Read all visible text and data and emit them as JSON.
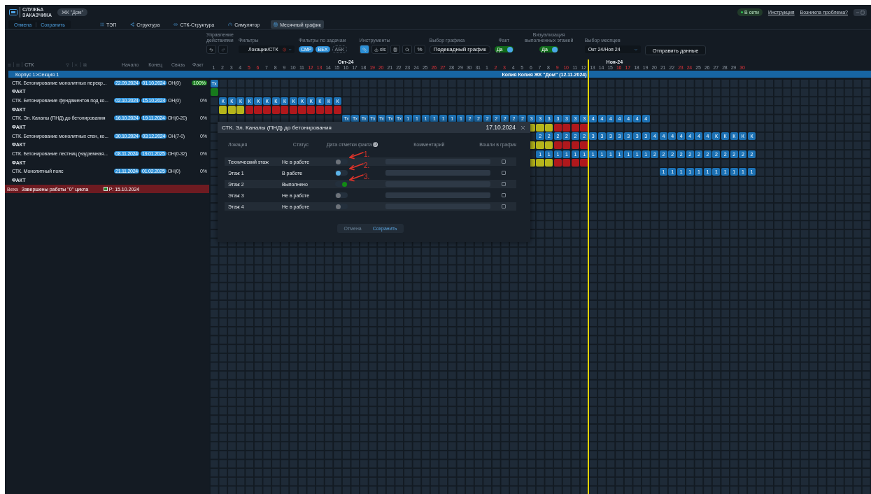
{
  "header": {
    "logo_text": "СЛУЖБА ЗАКАЗЧИКА",
    "project": "ЖК \"Дом\"",
    "online": "В сети",
    "links": [
      "Инструкция",
      "Возникла проблема?"
    ]
  },
  "actions": [
    "Отмена",
    "Сохранить"
  ],
  "tabs": [
    {
      "label": "ТЭП",
      "selected": false
    },
    {
      "label": "Структура",
      "selected": false
    },
    {
      "label": "СТК-Структура",
      "selected": false
    },
    {
      "label": "Симулятор",
      "selected": false
    },
    {
      "label": "Месячный график",
      "selected": true
    }
  ],
  "toolbar": {
    "history_label": "Управление действиями",
    "filters_label": "Фильтры",
    "filter_value": "Локации/СТК",
    "task_filters_label": "Фильтры по задачам",
    "task_filters": [
      {
        "label": "СМР",
        "on": true
      },
      {
        "label": "ВЕХ",
        "on": true
      },
      {
        "label": "АБК",
        "on": false
      }
    ],
    "tools_label": "Инструменты",
    "tools": [
      {
        "kind": "ruler",
        "selected": true
      },
      {
        "kind": "export",
        "label": "xls",
        "selected": false
      },
      {
        "kind": "calc",
        "selected": false
      },
      {
        "kind": "search",
        "selected": false
      },
      {
        "kind": "percent",
        "label": "%",
        "selected": false
      }
    ],
    "schedule_label": "Выбор графика",
    "schedule_value": "Подекадный график",
    "toggles": [
      {
        "label": "Факт",
        "value": "Да",
        "on": true
      },
      {
        "label": "Визуализация выполненных этажей",
        "value": "Да",
        "on": true
      }
    ],
    "months_label": "Выбор месяцев",
    "months_value": "Окт 24/Ноя 24",
    "submit": "Отправить данные"
  },
  "left_header": {
    "filter_text": "СТК",
    "columns": [
      "Начало",
      "Конец",
      "Связь",
      "Факт"
    ]
  },
  "months": [
    {
      "label": "Окт-24",
      "days": [
        {
          "label": "1",
          "weekend": false,
          "today": false
        },
        {
          "label": "2",
          "weekend": false,
          "today": false
        },
        {
          "label": "3",
          "weekend": false,
          "today": false
        },
        {
          "label": "4",
          "weekend": false,
          "today": false
        },
        {
          "label": "5",
          "weekend": true,
          "today": false
        },
        {
          "label": "6",
          "weekend": true,
          "today": false
        },
        {
          "label": "7",
          "weekend": false,
          "today": false
        },
        {
          "label": "8",
          "weekend": false,
          "today": false
        },
        {
          "label": "9",
          "weekend": false,
          "today": false
        },
        {
          "label": "10",
          "weekend": false,
          "today": false
        },
        {
          "label": "11",
          "weekend": false,
          "today": false
        },
        {
          "label": "12",
          "weekend": true,
          "today": false
        },
        {
          "label": "13",
          "weekend": true,
          "today": false
        },
        {
          "label": "14",
          "weekend": false,
          "today": false
        },
        {
          "label": "15",
          "weekend": false,
          "today": false
        },
        {
          "label": "16",
          "weekend": false,
          "today": false
        },
        {
          "label": "17",
          "weekend": false,
          "today": false
        },
        {
          "label": "18",
          "weekend": false,
          "today": false
        },
        {
          "label": "19",
          "weekend": true,
          "today": false
        },
        {
          "label": "20",
          "weekend": true,
          "today": false
        },
        {
          "label": "21",
          "weekend": false,
          "today": false
        },
        {
          "label": "22",
          "weekend": false,
          "today": false
        },
        {
          "label": "23",
          "weekend": false,
          "today": false
        },
        {
          "label": "24",
          "weekend": false,
          "today": false
        },
        {
          "label": "25",
          "weekend": false,
          "today": false
        },
        {
          "label": "26",
          "weekend": true,
          "today": false
        },
        {
          "label": "27",
          "weekend": true,
          "today": false
        },
        {
          "label": "28",
          "weekend": false,
          "today": false
        },
        {
          "label": "29",
          "weekend": false,
          "today": false
        },
        {
          "label": "30",
          "weekend": false,
          "today": false
        },
        {
          "label": "31",
          "weekend": false,
          "today": false
        }
      ]
    },
    {
      "label": "Ноя-24",
      "days": [
        {
          "label": "1",
          "weekend": false,
          "today": false
        },
        {
          "label": "2",
          "weekend": true,
          "today": false
        },
        {
          "label": "3",
          "weekend": true,
          "today": false
        },
        {
          "label": "4",
          "weekend": false,
          "today": false
        },
        {
          "label": "5",
          "weekend": false,
          "today": false
        },
        {
          "label": "6",
          "weekend": false,
          "today": false
        },
        {
          "label": "7",
          "weekend": false,
          "today": false
        },
        {
          "label": "8",
          "weekend": false,
          "today": false
        },
        {
          "label": "9",
          "weekend": true,
          "today": false
        },
        {
          "label": "10",
          "weekend": true,
          "today": false
        },
        {
          "label": "11",
          "weekend": false,
          "today": false
        },
        {
          "label": "12",
          "weekend": false,
          "today": true
        },
        {
          "label": "13",
          "weekend": false,
          "today": false
        },
        {
          "label": "14",
          "weekend": false,
          "today": false
        },
        {
          "label": "15",
          "weekend": false,
          "today": false
        },
        {
          "label": "16",
          "weekend": true,
          "today": false
        },
        {
          "label": "17",
          "weekend": true,
          "today": false
        },
        {
          "label": "18",
          "weekend": false,
          "today": false
        },
        {
          "label": "19",
          "weekend": false,
          "today": false
        },
        {
          "label": "20",
          "weekend": false,
          "today": false
        },
        {
          "label": "21",
          "weekend": false,
          "today": false
        },
        {
          "label": "22",
          "weekend": false,
          "today": false
        },
        {
          "label": "23",
          "weekend": true,
          "today": false
        },
        {
          "label": "24",
          "weekend": true,
          "today": false
        },
        {
          "label": "25",
          "weekend": false,
          "today": false
        },
        {
          "label": "26",
          "weekend": false,
          "today": false
        },
        {
          "label": "27",
          "weekend": false,
          "today": false
        },
        {
          "label": "28",
          "weekend": false,
          "today": false
        },
        {
          "label": "29",
          "weekend": false,
          "today": false
        },
        {
          "label": "30",
          "weekend": true,
          "today": false
        }
      ]
    }
  ],
  "section": {
    "label": "Корпус 1>Секция 1",
    "copy_label": "Копия Копия ЖК \"Дом\" (12.11.2024)"
  },
  "rows": [
    {
      "kind": "task",
      "name": "СТК. Бетонирование монолитных перекр...",
      "start": "22.09.2024",
      "end": "01.10.2024",
      "link": "ОН(0)",
      "fact": "100%",
      "fact_done": true,
      "cells": [
        "Тх"
      ]
    },
    {
      "kind": "fact",
      "name": "ФАКТ",
      "cells": [
        {
          "color": "#177a1c"
        }
      ]
    },
    {
      "kind": "task",
      "name": "СТК. Бетонирование фундаментов под ко...",
      "start": "02.10.2024",
      "end": "15.10.2024",
      "link": "ОН(0)",
      "fact": "0%",
      "fact_done": false,
      "cells": [
        null,
        "К",
        "К",
        "К",
        "К",
        "К",
        "К",
        "К",
        "К",
        "К",
        "К",
        "К",
        "К",
        "К",
        "К"
      ]
    },
    {
      "kind": "fact",
      "name": "ФАКТ",
      "cells": [
        null,
        {
          "color": "#b6b51b"
        },
        {
          "color": "#b6b51b"
        },
        {
          "color": "#b6b51b"
        },
        {
          "color": "#b0181c"
        },
        {
          "color": "#b0181c"
        },
        {
          "color": "#b0181c"
        },
        {
          "color": "#b0181c"
        },
        {
          "color": "#b0181c"
        },
        {
          "color": "#b0181c"
        },
        {
          "color": "#b0181c"
        },
        {
          "color": "#b0181c"
        },
        {
          "color": "#b0181c"
        },
        {
          "color": "#b0181c"
        },
        {
          "color": "#b0181c"
        }
      ]
    },
    {
      "kind": "task",
      "name": "СТК. Эл. Каналы (ПНД) до бетонирования",
      "start": "16.10.2024",
      "end": "19.11.2024",
      "link": "ОН(0-20)",
      "fact": "0%",
      "fact_done": false,
      "cells": [
        null,
        null,
        null,
        null,
        null,
        null,
        null,
        null,
        null,
        null,
        null,
        null,
        null,
        null,
        null,
        "Тх",
        "Тх",
        "Тх",
        "Тх",
        "Тх",
        "Тх",
        "Тх",
        "1",
        "1",
        "1",
        "1",
        "1",
        "1",
        "1",
        "2",
        "2",
        "2",
        "2",
        "2",
        "2",
        "2",
        "3",
        "3",
        "3",
        "3",
        "3",
        "3",
        "3",
        "4",
        "4",
        "4",
        "4",
        "4",
        "4",
        "4"
      ]
    },
    {
      "kind": "fact",
      "name": "ФАКТ",
      "cells": [
        null,
        null,
        null,
        null,
        null,
        null,
        null,
        null,
        null,
        null,
        null,
        null,
        null,
        null,
        null,
        null,
        null,
        null,
        null,
        null,
        null,
        null,
        null,
        null,
        null,
        null,
        null,
        null,
        null,
        null,
        null,
        null,
        null,
        null,
        null,
        null,
        {
          "color": "#b6b51b"
        },
        {
          "color": "#b6b51b"
        },
        {
          "color": "#b6b51b"
        },
        {
          "color": "#b0181c"
        },
        {
          "color": "#b0181c"
        },
        {
          "color": "#b0181c"
        },
        {
          "color": "#b0181c"
        }
      ]
    },
    {
      "kind": "task",
      "name": "СТК. Бетонирование монолитных стен, ко...",
      "start": "30.10.2024",
      "end": "03.12.2024",
      "link": "ОН(7-0)",
      "fact": "0%",
      "fact_done": false,
      "cells": [
        null,
        null,
        null,
        null,
        null,
        null,
        null,
        null,
        null,
        null,
        null,
        null,
        null,
        null,
        null,
        null,
        null,
        null,
        null,
        null,
        null,
        null,
        null,
        null,
        null,
        null,
        null,
        null,
        null,
        null,
        null,
        null,
        null,
        null,
        null,
        null,
        null,
        "2",
        "2",
        "2",
        "2",
        "2",
        "2",
        "3",
        "3",
        "3",
        "3",
        "3",
        "3",
        "3",
        "4",
        "4",
        "4",
        "4",
        "4",
        "4",
        "4",
        "К",
        "К",
        "К",
        "К",
        "К"
      ]
    },
    {
      "kind": "fact",
      "name": "ФАКТ",
      "cells": [
        null,
        null,
        null,
        null,
        null,
        null,
        null,
        null,
        null,
        null,
        null,
        null,
        null,
        null,
        null,
        null,
        null,
        null,
        null,
        null,
        null,
        null,
        null,
        null,
        null,
        null,
        null,
        null,
        null,
        null,
        null,
        null,
        null,
        null,
        null,
        null,
        {
          "color": "#b6b51b"
        },
        {
          "color": "#b6b51b"
        },
        {
          "color": "#b6b51b"
        },
        {
          "color": "#b0181c"
        },
        {
          "color": "#b0181c"
        },
        {
          "color": "#b0181c"
        },
        {
          "color": "#b0181c"
        }
      ]
    },
    {
      "kind": "task",
      "name": "СТК. Бетонирование лестниц (надземная...",
      "start": "08.11.2024",
      "end": "19.01.2025",
      "link": "ОН(0-32)",
      "fact": "0%",
      "fact_done": false,
      "cells": [
        null,
        null,
        null,
        null,
        null,
        null,
        null,
        null,
        null,
        null,
        null,
        null,
        null,
        null,
        null,
        null,
        null,
        null,
        null,
        null,
        null,
        null,
        null,
        null,
        null,
        null,
        null,
        null,
        null,
        null,
        null,
        null,
        null,
        null,
        null,
        null,
        null,
        "1",
        "1",
        "1",
        "1",
        "1",
        "1",
        "1",
        "1",
        "1",
        "1",
        "1",
        "1",
        "1",
        "2",
        "2",
        "2",
        "2",
        "2",
        "2",
        "2",
        "2",
        "2",
        "2",
        "2",
        "2"
      ]
    },
    {
      "kind": "fact",
      "name": "ФАКТ",
      "cells": [
        null,
        null,
        null,
        null,
        null,
        null,
        null,
        null,
        null,
        null,
        null,
        null,
        null,
        null,
        null,
        null,
        null,
        null,
        null,
        null,
        null,
        null,
        null,
        null,
        null,
        null,
        null,
        null,
        null,
        null,
        null,
        null,
        null,
        null,
        null,
        null,
        {
          "color": "#b6b51b"
        },
        {
          "color": "#b6b51b"
        },
        {
          "color": "#b6b51b"
        },
        {
          "color": "#b0181c"
        },
        {
          "color": "#b0181c"
        },
        {
          "color": "#b0181c"
        },
        {
          "color": "#b0181c"
        }
      ]
    },
    {
      "kind": "task",
      "name": "СТК. Монолитный пояс",
      "start": "21.11.2024",
      "end": "01.02.2025",
      "link": "ОН(0)",
      "fact": "0%",
      "fact_done": false,
      "cells": [
        null,
        null,
        null,
        null,
        null,
        null,
        null,
        null,
        null,
        null,
        null,
        null,
        null,
        null,
        null,
        null,
        null,
        null,
        null,
        null,
        null,
        null,
        null,
        null,
        null,
        null,
        null,
        null,
        null,
        null,
        null,
        null,
        null,
        null,
        null,
        null,
        null,
        null,
        null,
        null,
        null,
        null,
        null,
        null,
        null,
        null,
        null,
        null,
        null,
        null,
        null,
        "1",
        "1",
        "1",
        "1",
        "1",
        "1",
        "1",
        "1",
        "1",
        "1",
        "1"
      ]
    },
    {
      "kind": "fact",
      "name": "ФАКТ"
    },
    {
      "kind": "milestone",
      "tag": "Веха",
      "name": "Завершены работы \"0\" цикла",
      "date": "Р: 15.10.2024"
    }
  ],
  "modal": {
    "title": "СТК. Эл. Каналы (ПНД) до бетонирования",
    "date": "17.10.2024",
    "columns": [
      "Локация",
      "Статус",
      "Дата отметки факта",
      "Комментарий",
      "Вошли в график"
    ],
    "rows": [
      {
        "location": "Технический этаж",
        "status": "Не в работе",
        "toggle": {
          "on": false,
          "color": "#6e737a"
        },
        "annotation": "1.",
        "in_schedule": false
      },
      {
        "location": "Этаж 1",
        "status": "В работе",
        "toggle": {
          "on": false,
          "color": "#5cb4ea"
        },
        "annotation": "2.",
        "in_schedule": false
      },
      {
        "location": "Этаж 2",
        "status": "Выполнено",
        "toggle": {
          "on": true,
          "color": "#128a14"
        },
        "annotation": "3.",
        "in_schedule": false
      },
      {
        "location": "Этаж 3",
        "status": "Не в работе",
        "toggle": {
          "on": false,
          "color": "#6e737a"
        },
        "in_schedule": false
      },
      {
        "location": "Этаж 4",
        "status": "Не в работе",
        "toggle": {
          "on": false,
          "color": "#6e737a"
        },
        "in_schedule": false
      }
    ],
    "buttons": [
      {
        "label": "Отмена",
        "disabled": true
      },
      {
        "label": "Сохранить",
        "disabled": false
      }
    ]
  }
}
